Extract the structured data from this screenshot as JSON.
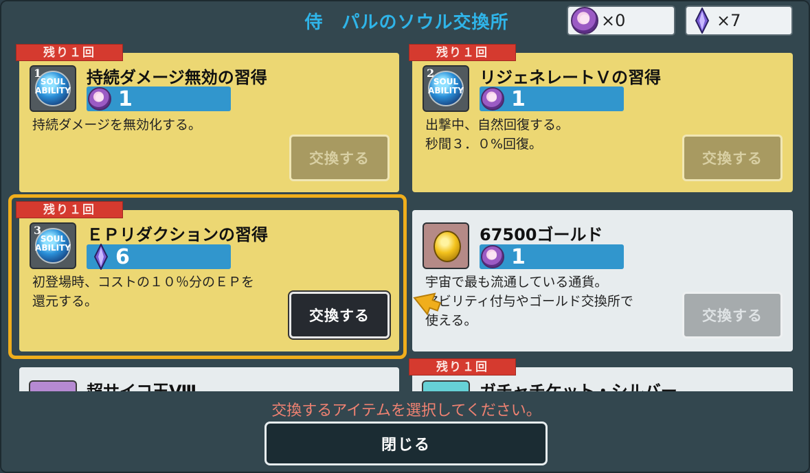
{
  "header": {
    "title": "侍　パルのソウル交換所",
    "soul_count": "×0",
    "crystal_count": "×7"
  },
  "items": [
    {
      "badge": "残り１回",
      "icon_number": "1",
      "icon_label": "SOUL ABILITY",
      "name": "持続ダメージ無効の習得",
      "cost": "1",
      "cost_currency": "soul",
      "desc_line1": "持続ダメージを無効化する。",
      "desc_line2": "",
      "button": "交換する",
      "enabled": false
    },
    {
      "badge": "残り１回",
      "icon_number": "2",
      "icon_label": "SOUL ABILITY",
      "name": "リジェネレートＶの習得",
      "cost": "1",
      "cost_currency": "soul",
      "desc_line1": "出撃中、自然回復する。",
      "desc_line2": "秒間３．０%回復。",
      "button": "交換する",
      "enabled": false
    },
    {
      "badge": "残り１回",
      "icon_number": "3",
      "icon_label": "SOUL ABILITY",
      "name": "ＥＰリダクションの習得",
      "cost": "6",
      "cost_currency": "crystal",
      "desc_line1": "初登場時、コストの１０％分のＥＰを",
      "desc_line2": "還元する。",
      "button": "交換する",
      "enabled": true
    },
    {
      "badge": "",
      "icon_number": "",
      "icon_label": "",
      "name": "67500ゴールド",
      "cost": "1",
      "cost_currency": "soul",
      "desc_line1": "宇宙で最も流通している通貨。",
      "desc_line2": "アビリティ付与やゴールド交換所で",
      "desc_line3": "使える。",
      "button": "交換する",
      "enabled": false
    },
    {
      "name": "超サイコ玉Ⅷ"
    },
    {
      "badge": "残り１回",
      "name": "ガチャチケット・シルバー"
    }
  ],
  "footer": {
    "instruction": "交換するアイテムを選択してください。",
    "close_label": "閉じる"
  },
  "colors": {
    "accent_title": "#2fb4e8",
    "badge_red": "#d53a2f",
    "highlight": "#f0ae1c",
    "cost_bar": "#3196cd"
  }
}
